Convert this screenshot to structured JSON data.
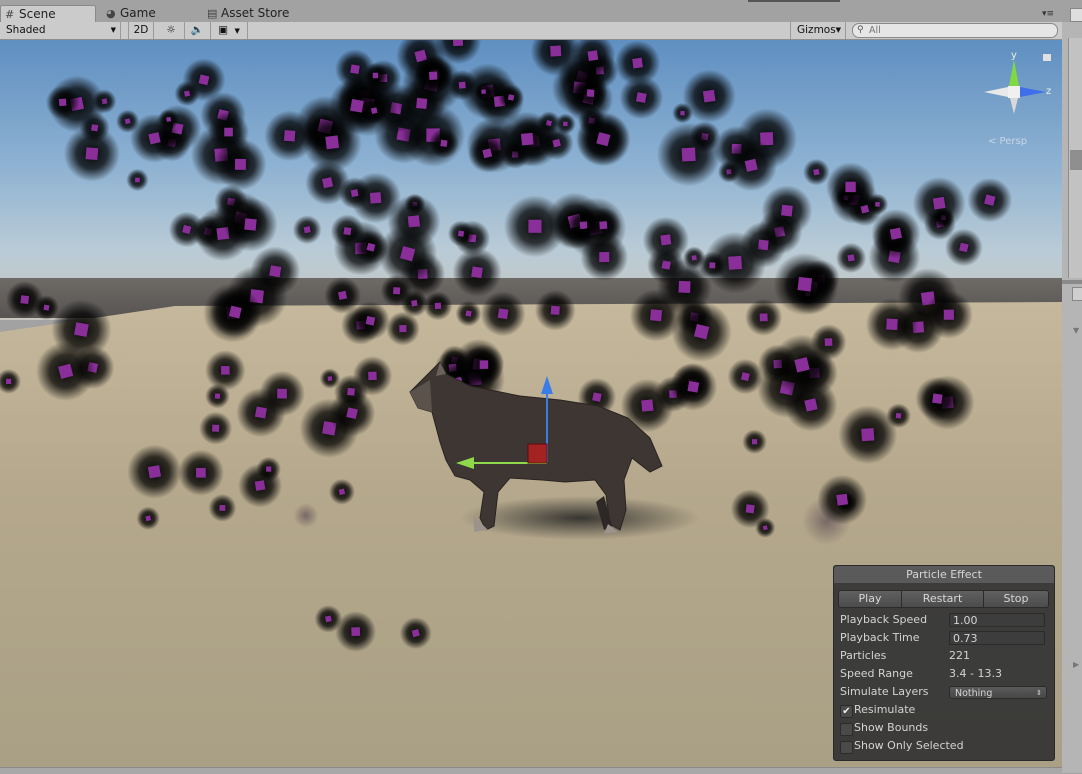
{
  "tabs": [
    {
      "label": "Scene",
      "icon": "hash-grid-icon"
    },
    {
      "label": "Game",
      "icon": "pacman-icon"
    },
    {
      "label": "Asset Store",
      "icon": "shopping-bag-icon"
    }
  ],
  "toolbar": {
    "shading_mode": "Shaded",
    "mode_2d": "2D",
    "lighting_icon": "sun-icon",
    "audio_icon": "speaker-icon",
    "effects_icon": "image-icon",
    "gizmos_label": "Gizmos",
    "search_placeholder": "All"
  },
  "orientation_gizmo": {
    "y_label": "y",
    "z_label": "z",
    "projection": "< Persp",
    "colors": {
      "y": "#7fd93f",
      "z": "#3f6fe8",
      "x_neg": "#e8e8e8"
    }
  },
  "particle_effect": {
    "title": "Particle Effect",
    "buttons": {
      "play": "Play",
      "restart": "Restart",
      "stop": "Stop"
    },
    "playback_speed": {
      "label": "Playback Speed",
      "value": "1.00"
    },
    "playback_time": {
      "label": "Playback Time",
      "value": "0.73"
    },
    "particles": {
      "label": "Particles",
      "value": "221"
    },
    "speed_range": {
      "label": "Speed Range",
      "value": "3.4 - 13.3"
    },
    "simulate_layers": {
      "label": "Simulate Layers",
      "value": "Nothing"
    },
    "resimulate": {
      "label": "Resimulate",
      "checked": true
    },
    "show_bounds": {
      "label": "Show Bounds",
      "checked": false
    },
    "show_only_selected": {
      "label": "Show Only Selected",
      "checked": false
    }
  },
  "scene": {
    "particle_color": "#8a2f9a",
    "sky_color": "#6f9bc8",
    "ground_color": "#bdb095",
    "transform_handle_colors": {
      "x": "#8ed94a",
      "y": "#3a7de8",
      "z": "#b52020"
    }
  }
}
